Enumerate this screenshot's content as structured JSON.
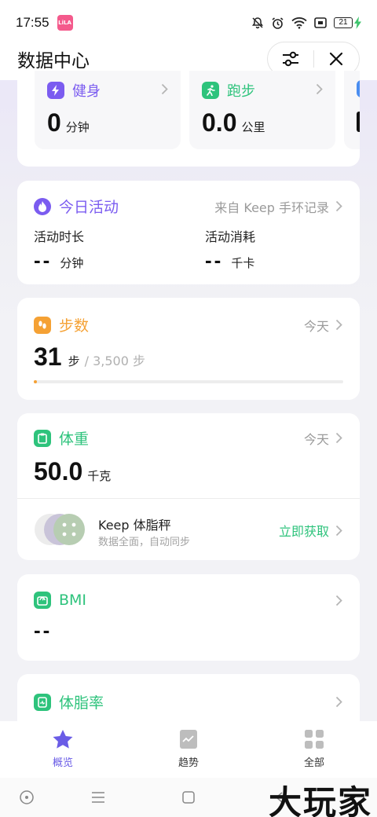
{
  "status_bar": {
    "time": "17:55",
    "app_icon_text": "LiLA",
    "battery": "21"
  },
  "header": {
    "title": "数据中心"
  },
  "top_tiles": [
    {
      "label": "健身",
      "value": "0",
      "unit": "分钟",
      "color": "#7b5cf0"
    },
    {
      "label": "跑步",
      "value": "0.0",
      "unit": "公里",
      "color": "#2ec37c"
    }
  ],
  "activity": {
    "title": "今日活动",
    "source": "来自 Keep 手环记录",
    "duration_label": "活动时长",
    "duration_value": "--",
    "duration_unit": "分钟",
    "burn_label": "活动消耗",
    "burn_value": "--",
    "burn_unit": "千卡",
    "color": "#7b5cf0"
  },
  "steps": {
    "title": "步数",
    "period": "今天",
    "value": "31",
    "unit": "步",
    "goal": "/ 3,500 步",
    "progress": 0.009,
    "color": "#f5a134"
  },
  "weight": {
    "title": "体重",
    "period": "今天",
    "value": "50.0",
    "unit": "千克",
    "color": "#2ec37c",
    "promo_title": "Keep 体脂秤",
    "promo_subtitle": "数据全面，自动同步",
    "promo_action": "立即获取"
  },
  "bmi": {
    "title": "BMI",
    "value": "--",
    "color": "#2ec37c"
  },
  "body_fat": {
    "title": "体脂率",
    "color": "#2ec37c"
  },
  "tabs": [
    {
      "label": "概览",
      "icon": "star-icon",
      "active": true
    },
    {
      "label": "趋势",
      "icon": "trend-icon",
      "active": false
    },
    {
      "label": "全部",
      "icon": "grid-icon",
      "active": false
    }
  ],
  "watermark": "大玩家",
  "accent": "#6a5ce6"
}
